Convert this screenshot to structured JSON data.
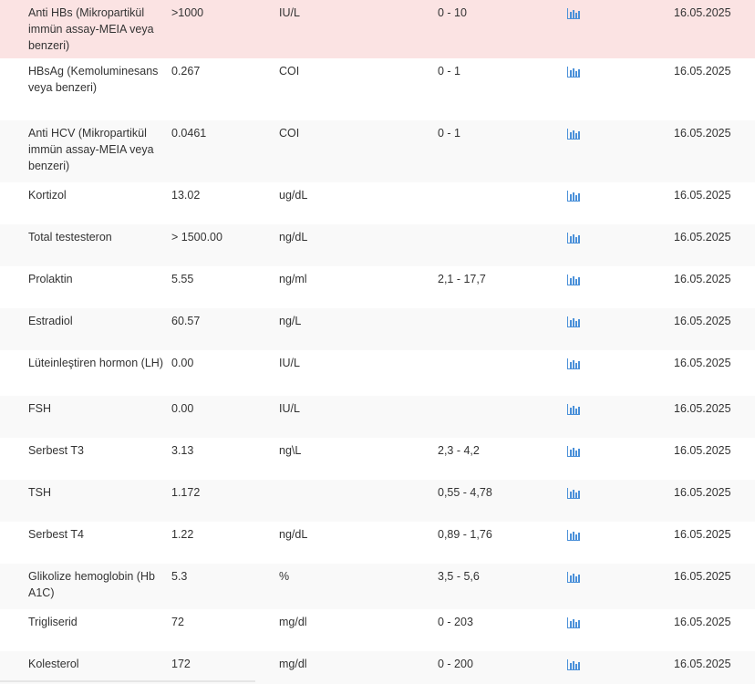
{
  "colors": {
    "abnormal_row_bg": "#fbe3e3",
    "alt_row_bg": "#f9f9f9",
    "chart_icon": "#4a90d9"
  },
  "icons": {
    "trend": "bar-chart-icon"
  },
  "rows": [
    {
      "name": "Anti HBs (Mikropartikül immün assay-MEIA veya benzeri)",
      "value": ">1000",
      "unit": "IU/L",
      "ref": "0 - 10",
      "date": "16.05.2025",
      "abnormal": true
    },
    {
      "name": "HBsAg (Kemoluminesans veya benzeri)",
      "value": "0.267",
      "unit": "COI",
      "ref": "0 - 1",
      "date": "16.05.2025"
    },
    {
      "name": "Anti HCV (Mikropartikül immün assay-MEIA veya benzeri)",
      "value": "0.0461",
      "unit": "COI",
      "ref": "0 - 1",
      "date": "16.05.2025"
    },
    {
      "name": "Kortizol",
      "value": "13.02",
      "unit": "ug/dL",
      "ref": "",
      "date": "16.05.2025"
    },
    {
      "name": "Total testesteron",
      "value": "> 1500.00",
      "unit": "ng/dL",
      "ref": "",
      "date": "16.05.2025"
    },
    {
      "name": "Prolaktin",
      "value": "5.55",
      "unit": "ng/ml",
      "ref": "2,1 - 17,7",
      "date": "16.05.2025"
    },
    {
      "name": "Estradiol",
      "value": "60.57",
      "unit": "ng/L",
      "ref": "",
      "date": "16.05.2025"
    },
    {
      "name": "Lüteinleştiren hormon (LH)",
      "value": "0.00",
      "unit": "IU/L",
      "ref": "",
      "date": "16.05.2025"
    },
    {
      "name": "FSH",
      "value": "0.00",
      "unit": "IU/L",
      "ref": "",
      "date": "16.05.2025"
    },
    {
      "name": "Serbest T3",
      "value": "3.13",
      "unit": "ng\\L",
      "ref": "2,3 - 4,2",
      "date": "16.05.2025"
    },
    {
      "name": "TSH",
      "value": "1.172",
      "unit": "",
      "ref": "0,55 - 4,78",
      "date": "16.05.2025"
    },
    {
      "name": "Serbest T4",
      "value": "1.22",
      "unit": "ng/dL",
      "ref": "0,89 - 1,76",
      "date": "16.05.2025"
    },
    {
      "name": "Glikolize hemoglobin (Hb A1C)",
      "value": "5.3",
      "unit": "%",
      "ref": "3,5 - 5,6",
      "date": "16.05.2025"
    },
    {
      "name": "Trigliserid",
      "value": "72",
      "unit": "mg/dl",
      "ref": "0 - 203",
      "date": "16.05.2025"
    },
    {
      "name": "Kolesterol",
      "value": "172",
      "unit": "mg/dl",
      "ref": "0 - 200",
      "date": "16.05.2025"
    }
  ]
}
